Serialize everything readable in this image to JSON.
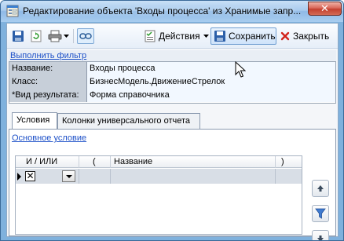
{
  "window": {
    "title": "Редактирование объекта 'Входы процесса' из Хранимые запр...",
    "close_glyph": "✕"
  },
  "toolbar": {
    "actions_label": "Действия",
    "save_label": "Сохранить",
    "close_label": "Закрыть"
  },
  "filter": {
    "link_label": "Выполнить фильтр"
  },
  "properties": [
    {
      "name": "Название:",
      "value": "Входы процесса"
    },
    {
      "name": "Класс:",
      "value": "БизнесМодель.ДвижениеСтрелок"
    },
    {
      "name": "*Вид результата:",
      "value": "Форма справочника"
    }
  ],
  "tabs": [
    {
      "label": "Условия",
      "active": true
    },
    {
      "label": "Колонки универсального отчета",
      "active": false
    }
  ],
  "conditions": {
    "main_link": "Основное условие",
    "columns": [
      "И / ИЛИ",
      "(",
      "Название",
      ")"
    ],
    "rows": [
      {
        "checkbox_glyph": "✕"
      }
    ]
  },
  "colors": {
    "accent": "#1d50c8",
    "title_gradient_top": "#c9e0f6",
    "close_red": "#c3402f"
  },
  "icons": {
    "title": "form-icon",
    "save": "floppy-disk-icon",
    "refresh": "refresh-icon",
    "print": "printer-icon",
    "link": "link-icon",
    "actions": "checklist-icon",
    "close": "red-x-icon",
    "up": "arrow-up-icon",
    "filter": "funnel-icon",
    "down": "arrow-down-icon"
  }
}
